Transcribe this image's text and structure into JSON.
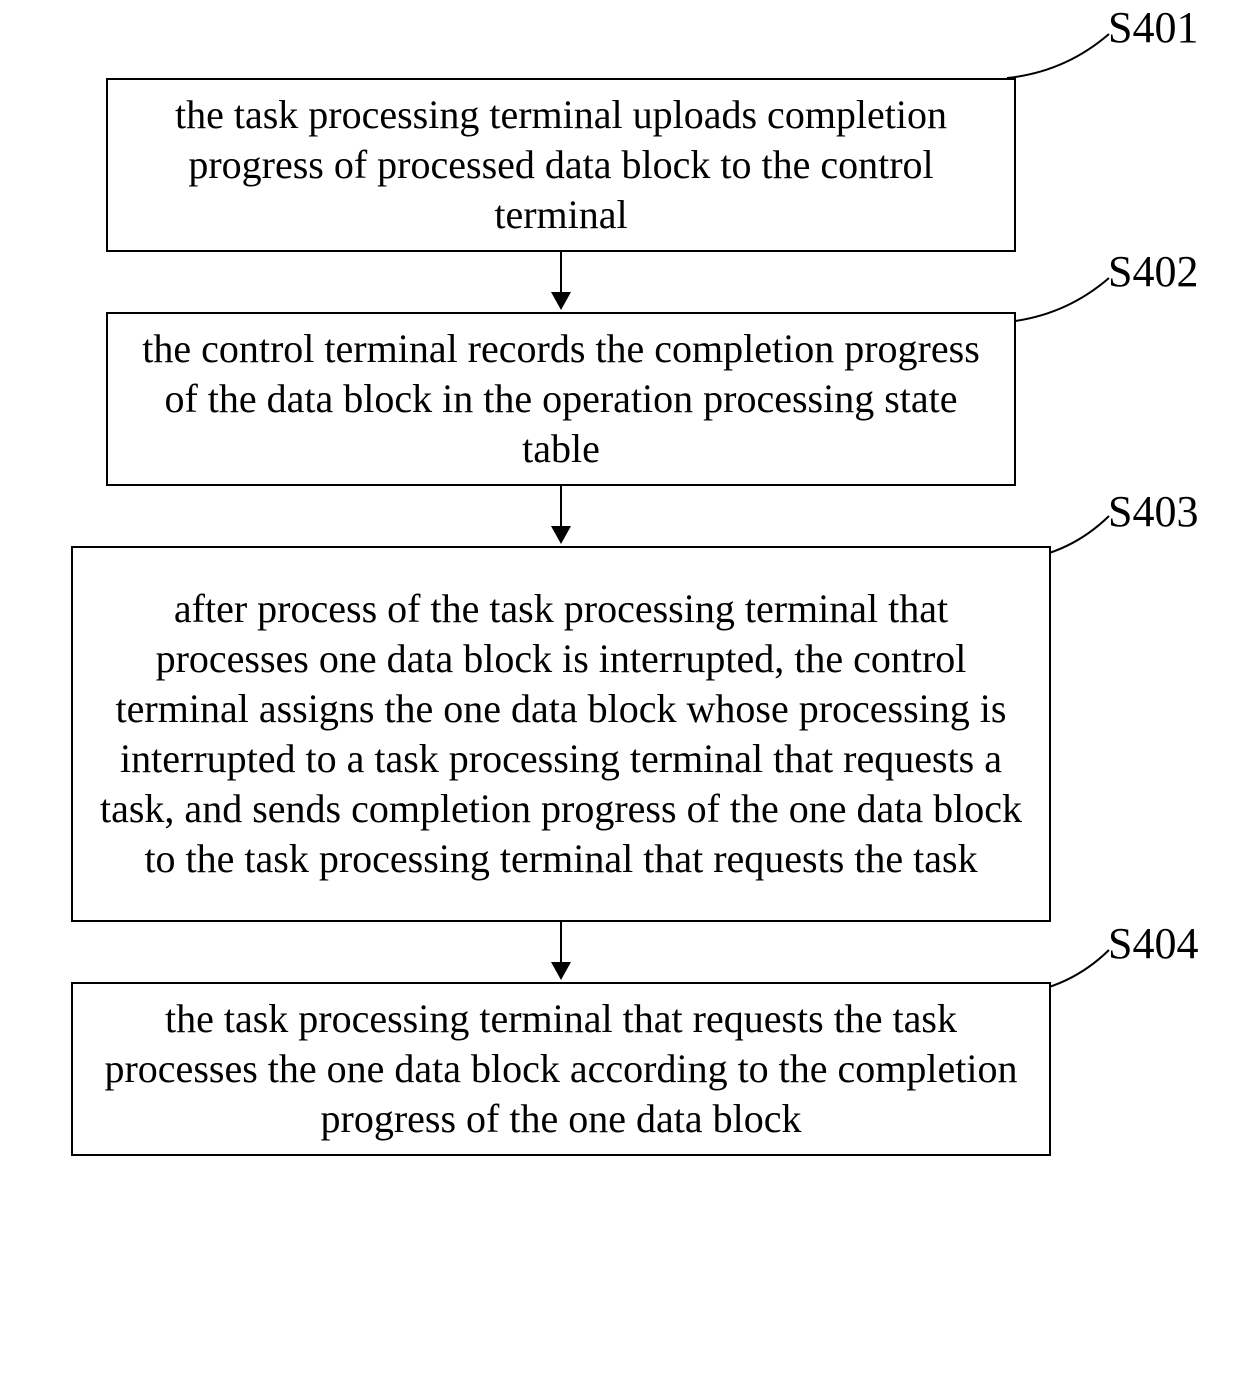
{
  "chart_data": {
    "type": "flowchart",
    "steps": [
      {
        "id": "S401",
        "text": "the task processing terminal uploads completion progress of processed data block to the control terminal"
      },
      {
        "id": "S402",
        "text": "the control terminal records the completion progress of the data block in the operation processing state table"
      },
      {
        "id": "S403",
        "text": "after process of the task processing terminal that processes one data block is interrupted, the control terminal assigns the one data block whose processing is interrupted to a task processing terminal that requests a task, and sends completion progress of the one data block to the task processing terminal that requests the task"
      },
      {
        "id": "S404",
        "text": "the task processing terminal that requests the task processes the one data block according to the completion progress of the one data block"
      }
    ],
    "edges": [
      [
        "S401",
        "S402"
      ],
      [
        "S402",
        "S403"
      ],
      [
        "S403",
        "S404"
      ]
    ]
  }
}
